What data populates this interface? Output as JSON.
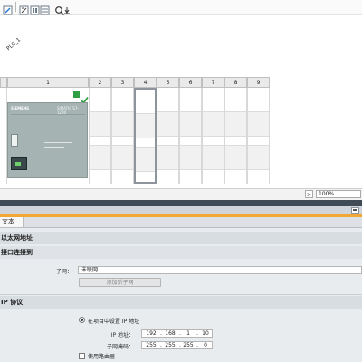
{
  "toolbar": {
    "buttons": [
      {
        "name": "edit-icon"
      },
      {
        "name": "device-view-icon"
      },
      {
        "name": "network-view-icon"
      },
      {
        "name": "topology-view-icon"
      },
      {
        "name": "zoom-icon"
      },
      {
        "name": "zoom-step-icon"
      }
    ]
  },
  "canvas": {
    "plc_tag": "PLC_1"
  },
  "rack": {
    "columns": [
      "1",
      "2",
      "3",
      "4",
      "5",
      "6",
      "7",
      "8",
      "9"
    ],
    "selected_column": "4",
    "cpu_brand": "SIEMENS",
    "cpu_model": "SIMATIC S7-1200"
  },
  "zoom": {
    "arrow": ">",
    "value": "100%"
  },
  "inspector": {
    "tab_text": "文本",
    "section_ethernet": "以太网地址",
    "section_interface": "接口连接到",
    "subnet_label": "子网：",
    "subnet_value": "未联网",
    "add_subnet_button": "添加新子网",
    "section_ip": "IP 协议",
    "radio_set_ip_label": "在项目中设置 IP 地址",
    "ip_label": "IP 地址：",
    "ip_octets": [
      "192",
      "168",
      "1",
      "10"
    ],
    "mask_label": "子网掩码：",
    "mask_octets": [
      "255",
      "255",
      "255",
      "0"
    ],
    "router_label": "使用路由器"
  }
}
